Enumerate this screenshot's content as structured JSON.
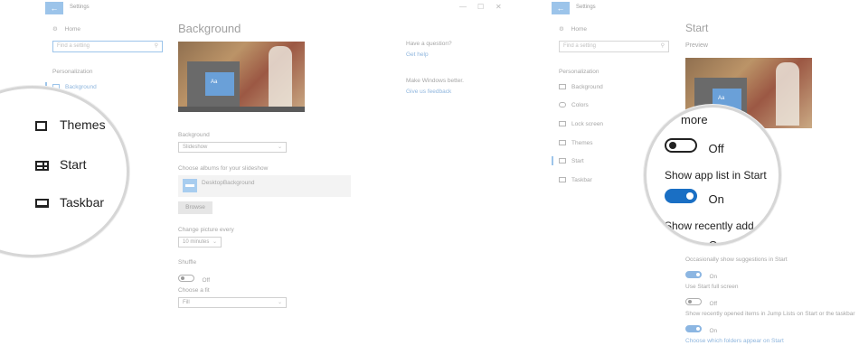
{
  "left_window": {
    "title": "Settings",
    "back_icon": "arrow-left-icon",
    "home_label": "Home",
    "search_placeholder": "Find a setting",
    "section_label": "Personalization",
    "nav_selected": "Background",
    "zoom_items": [
      {
        "icon": "themes-icon",
        "label": "Themes"
      },
      {
        "icon": "start-icon",
        "label": "Start"
      },
      {
        "icon": "taskbar-icon",
        "label": "Taskbar"
      }
    ],
    "page_title": "Background",
    "preview_tile_label": "Aa",
    "background_label": "Background",
    "background_value": "Slideshow",
    "albums_label": "Choose albums for your slideshow",
    "album_name": "DesktopBackground",
    "browse_label": "Browse",
    "change_label": "Change picture every",
    "change_value": "10 minutes",
    "shuffle_label": "Shuffle",
    "shuffle_state": "Off",
    "fit_label": "Choose a fit",
    "fit_value": "Fill",
    "question_heading": "Have a question?",
    "get_help": "Get help",
    "better_heading": "Make Windows better.",
    "feedback": "Give us feedback",
    "window_controls": [
      "—",
      "☐",
      "✕"
    ]
  },
  "right_window": {
    "title": "Settings",
    "home_label": "Home",
    "search_placeholder": "Find a setting",
    "section_label": "Personalization",
    "nav_items": [
      {
        "icon": "picture-icon",
        "label": "Background"
      },
      {
        "icon": "palette-icon",
        "label": "Colors"
      },
      {
        "icon": "monitor-icon",
        "label": "Lock screen"
      },
      {
        "icon": "brush-icon",
        "label": "Themes"
      },
      {
        "icon": "start-icon",
        "label": "Start"
      },
      {
        "icon": "taskbar-icon",
        "label": "Taskbar"
      }
    ],
    "page_title": "Start",
    "preview_label": "Preview",
    "preview_tile_label": "Aa",
    "zoom_partial_top": "more",
    "zoom_off_label": "Off",
    "zoom_app_list_label": "Show app list in Start",
    "zoom_on_label": "On",
    "zoom_recent_label": "Show recently add",
    "zoom_partial_bottom": "O",
    "suggestions_label": "Occasionally show suggestions in Start",
    "suggestions_state": "On",
    "fullscreen_label": "Use Start full screen",
    "fullscreen_state": "Off",
    "jumplists_label": "Show recently opened items in Jump Lists on Start or the taskbar",
    "jumplists_state": "On",
    "folders_link": "Choose which folders appear on Start"
  },
  "colors": {
    "accent": "#1a6fc4",
    "accent_faded": "#8cb6e2"
  }
}
